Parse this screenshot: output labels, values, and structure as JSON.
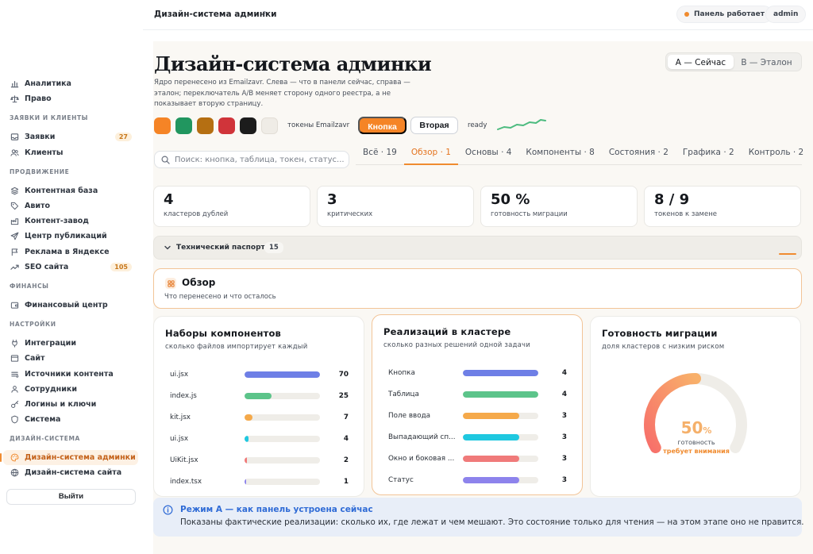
{
  "topbar": {
    "title": "Дизайн-система админки",
    "help": "?",
    "status": "Панель работает",
    "user": "admin"
  },
  "sidebar": {
    "items": [
      {
        "label": "Аналитика",
        "icon": "chart-icon"
      },
      {
        "label": "Право",
        "icon": "scale-icon"
      },
      {
        "section": "ЗАЯВКИ И КЛИЕНТЫ"
      },
      {
        "label": "Заявки",
        "icon": "inbox-icon",
        "badge": "27"
      },
      {
        "label": "Клиенты",
        "icon": "users-icon"
      },
      {
        "section": "ПРОДВИЖЕНИЕ"
      },
      {
        "label": "Контентная база",
        "icon": "layers-icon"
      },
      {
        "label": "Авито",
        "icon": "tag-icon"
      },
      {
        "label": "Контент-завод",
        "icon": "factory-icon"
      },
      {
        "label": "Центр публикаций",
        "icon": "send-icon"
      },
      {
        "label": "Реклама в Яндексе",
        "icon": "flag-icon"
      },
      {
        "label": "SEO сайта",
        "icon": "trend-icon",
        "badge": "105"
      },
      {
        "section": "ФИНАНСЫ"
      },
      {
        "label": "Финансовый центр",
        "icon": "wallet-icon"
      },
      {
        "section": "НАСТРОЙКИ"
      },
      {
        "label": "Интеграции",
        "icon": "plug-icon"
      },
      {
        "label": "Сайт",
        "icon": "window-icon"
      },
      {
        "label": "Источники контента",
        "icon": "source-icon"
      },
      {
        "label": "Сотрудники",
        "icon": "team-icon"
      },
      {
        "label": "Логины и ключи",
        "icon": "key-icon"
      },
      {
        "label": "Система",
        "icon": "shield-icon"
      },
      {
        "section": "ДИЗАЙН-СИСТЕМА"
      },
      {
        "label": "Дизайн-система админки",
        "icon": "palette-icon",
        "active": true
      },
      {
        "label": "Дизайн-система сайта",
        "icon": "globe-icon"
      }
    ],
    "logout": "Выйти"
  },
  "header": {
    "title": "Дизайн-система админки",
    "description": "Ядро перенесено из Emailzavr. Слева — что в панели сейчас, справа — эталон; переключатель A/B меняет сторону одного реестра, а не показывает вторую страницу.",
    "toggle_a": "A — Сейчас",
    "toggle_b": "B — Эталон"
  },
  "tokens": {
    "swatches": [
      "#f58426",
      "#21965f",
      "#b56f12",
      "#d0343a",
      "#1c1c1c",
      "#efece6"
    ],
    "label": "токены Emailzavr",
    "primary": "Кнопка",
    "secondary": "Вторая",
    "ready": "ready"
  },
  "search": {
    "placeholder": "Поиск: кнопка, таблица, токен, статус..."
  },
  "tabs": [
    {
      "label": "Всё · 19"
    },
    {
      "label": "Обзор · 1",
      "active": true
    },
    {
      "label": "Основы · 4"
    },
    {
      "label": "Компоненты · 8"
    },
    {
      "label": "Состояния · 2"
    },
    {
      "label": "Графика · 2"
    },
    {
      "label": "Контроль · 2"
    }
  ],
  "kpis": [
    {
      "value": "4",
      "label": "кластеров дублей"
    },
    {
      "value": "3",
      "label": "критических"
    },
    {
      "value": "50 %",
      "label": "готовность миграции"
    },
    {
      "value": "8 / 9",
      "label": "токенов к замене"
    }
  ],
  "passport": {
    "title": "Технический паспорт",
    "count": "15"
  },
  "overview": {
    "title": "Обзор",
    "subtitle": "Что перенесено и что осталось"
  },
  "card1": {
    "title": "Наборы компонентов",
    "subtitle": "сколько файлов импортирует каждый",
    "max": 70,
    "rows": [
      {
        "name": "ui.jsx",
        "value": 70,
        "color": "#6e7fe6"
      },
      {
        "name": "index.js",
        "value": 25,
        "color": "#5cc48a"
      },
      {
        "name": "kit.jsx",
        "value": 7,
        "color": "#f5a94a"
      },
      {
        "name": "ui.jsx",
        "value": 4,
        "color": "#1fc8e0"
      },
      {
        "name": "UiKit.jsx",
        "value": 2,
        "color": "#f07a7a"
      },
      {
        "name": "index.tsx",
        "value": 1,
        "color": "#8d83ec"
      }
    ]
  },
  "card2": {
    "title": "Реализаций в кластере",
    "subtitle": "сколько разных решений одной задачи",
    "max": 4,
    "rows": [
      {
        "name": "Кнопка",
        "value": 4,
        "color": "#6e7fe6"
      },
      {
        "name": "Таблица",
        "value": 4,
        "color": "#5cc48a"
      },
      {
        "name": "Поле ввода",
        "value": 3,
        "color": "#f5a94a"
      },
      {
        "name": "Выпадающий сп...",
        "value": 3,
        "color": "#1fc8e0"
      },
      {
        "name": "Окно и боковая ...",
        "value": 3,
        "color": "#f07a7a"
      },
      {
        "name": "Статус",
        "value": 3,
        "color": "#8d83ec"
      }
    ]
  },
  "card3": {
    "title": "Готовность миграции",
    "subtitle": "доля кластеров с низким риском",
    "value": "50",
    "unit": "%",
    "fraction": 0.5,
    "label": "готовность",
    "status": "требует внимания"
  },
  "info": {
    "title": "Режим A — как панель устроена сейчас",
    "text": "Показаны фактические реализации: сколько их, где лежат и чем мешают. Это состояние только для чтения — на этом этапе оно не правится."
  }
}
